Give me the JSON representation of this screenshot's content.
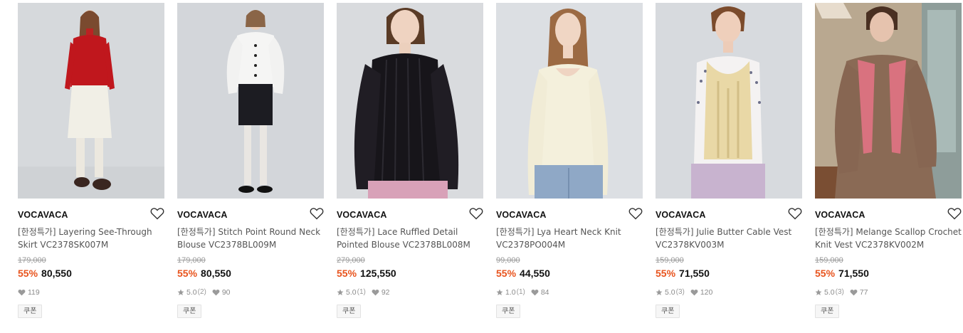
{
  "products": [
    {
      "brand": "VOCAVACA",
      "name": "[한정특가] Layering See-Through Skirt VC2378SK007M",
      "original_price": "179,000",
      "discount": "55%",
      "price": "80,550",
      "rating": "",
      "review_count": "",
      "likes": "119",
      "coupon": "쿠폰",
      "wish_icon": "heart-outline-icon",
      "image": "model-red-sweater-white-lace-skirt"
    },
    {
      "brand": "VOCAVACA",
      "name": "[한정특가] Stitch Point Round Neck Blouse VC2378BL009M",
      "original_price": "179,000",
      "discount": "55%",
      "price": "80,550",
      "rating": "5.0",
      "review_count": "(2)",
      "likes": "90",
      "coupon": "쿠폰",
      "wish_icon": "heart-outline-icon",
      "image": "model-white-blouse-black-skirt"
    },
    {
      "brand": "VOCAVACA",
      "name": "[한정특가] Lace Ruffled Detail Pointed Blouse VC2378BL008M",
      "original_price": "279,000",
      "discount": "55%",
      "price": "125,550",
      "rating": "5.0",
      "review_count": "(1)",
      "likes": "92",
      "coupon": "쿠폰",
      "wish_icon": "heart-outline-icon",
      "image": "model-black-ruffled-lace-blouse"
    },
    {
      "brand": "VOCAVACA",
      "name": "[한정특가] Lya Heart Neck Knit VC2378PO004M",
      "original_price": "99,000",
      "discount": "55%",
      "price": "44,550",
      "rating": "1.0",
      "review_count": "(1)",
      "likes": "84",
      "coupon": "쿠폰",
      "wish_icon": "heart-outline-icon",
      "image": "model-cream-knit-jeans"
    },
    {
      "brand": "VOCAVACA",
      "name": "[한정특가] Julie Butter Cable Vest VC2378KV003M",
      "original_price": "159,000",
      "discount": "55%",
      "price": "71,550",
      "rating": "5.0",
      "review_count": "(3)",
      "likes": "120",
      "coupon": "쿠폰",
      "wish_icon": "heart-outline-icon",
      "image": "model-butter-cable-vest"
    },
    {
      "brand": "VOCAVACA",
      "name": "[한정특가] Melange Scallop Crochet Knit Vest VC2378KV002M",
      "original_price": "159,000",
      "discount": "55%",
      "price": "71,550",
      "rating": "5.0",
      "review_count": "(3)",
      "likes": "77",
      "coupon": "쿠폰",
      "wish_icon": "heart-outline-icon",
      "image": "model-pink-crochet-vest-brown-dress"
    }
  ],
  "colors": {
    "discount": "#e8541e",
    "price": "#111111",
    "muted": "#9a9a9a"
  },
  "icons": [
    "heart-outline-icon",
    "star-icon",
    "heart-filled-icon"
  ]
}
